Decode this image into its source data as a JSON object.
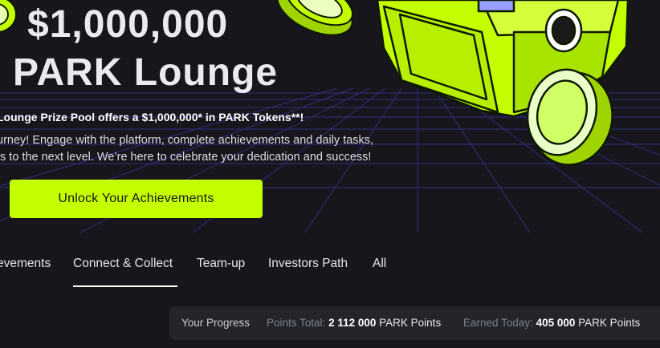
{
  "hero": {
    "title_line1": "$1,000,000",
    "title_line2": "PARK Lounge",
    "prize_line": "Lounge Prize Pool offers a $1,000,000* in PARK Tokens**!",
    "desc_line1": "urney! Engage with the platform, complete achievements and daily tasks,",
    "desc_line2": "ts to the next level. We’re here to celebrate your dedication and success!",
    "cta_label": "Unlock Your Achievements",
    "accent_color": "#c4ff00"
  },
  "tabs": [
    {
      "label": "evements",
      "active": false
    },
    {
      "label": "Connect & Collect",
      "active": true
    },
    {
      "label": "Team-up",
      "active": false
    },
    {
      "label": "Investors Path",
      "active": false
    },
    {
      "label": "All",
      "active": false
    }
  ],
  "progress": {
    "heading": "Your Progress",
    "total_label": "Points Total:",
    "total_value": "2 112 000",
    "total_unit": "PARK Points",
    "today_label": "Earned Today:",
    "today_value": "405 000",
    "today_unit": "PARK Points"
  }
}
